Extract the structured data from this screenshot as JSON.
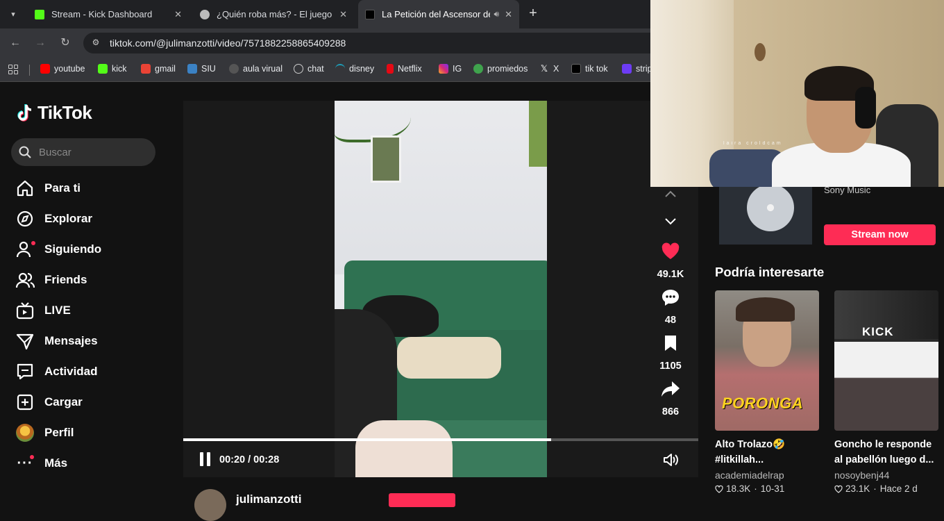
{
  "browser": {
    "tabs": [
      {
        "title": "Stream - Kick Dashboard",
        "active": false
      },
      {
        "title": "¿Quién roba más? - El juego qu",
        "active": false
      },
      {
        "title": "La Petición del Ascensor de",
        "active": true
      }
    ],
    "url": "tiktok.com/@julimanzotti/video/7571882258865409288",
    "bookmarks": [
      "youtube",
      "kick",
      "gmail",
      "SIU",
      "aula virual",
      "chat",
      "disney",
      "Netflix",
      "IG",
      "promiedos",
      "X",
      "tik tok",
      "strip"
    ]
  },
  "sidebar": {
    "logo": "TikTok",
    "search_placeholder": "Buscar",
    "items": [
      {
        "label": "Para ti",
        "icon": "home-icon"
      },
      {
        "label": "Explorar",
        "icon": "compass-icon"
      },
      {
        "label": "Siguiendo",
        "icon": "following-icon"
      },
      {
        "label": "Friends",
        "icon": "friends-icon"
      },
      {
        "label": "LIVE",
        "icon": "live-icon"
      },
      {
        "label": "Mensajes",
        "icon": "messages-icon"
      },
      {
        "label": "Actividad",
        "icon": "activity-icon"
      },
      {
        "label": "Cargar",
        "icon": "upload-icon"
      },
      {
        "label": "Perfil",
        "icon": "avatar-icon"
      },
      {
        "label": "Más",
        "icon": "more-icon"
      }
    ]
  },
  "player": {
    "time": "00:20 / 00:28",
    "progress": 0.714,
    "author": "julimanzotti"
  },
  "actions": {
    "likes": "49.1K",
    "comments": "48",
    "saves": "1105",
    "shares": "866"
  },
  "music": {
    "artist": "Sony Music",
    "stream_label": "Stream now"
  },
  "recommendations": {
    "title": "Podría interesarte",
    "items": [
      {
        "caption": "Alto Trolazo🤣 #litkillah...",
        "author": "academiadelrap",
        "likes": "18.3K",
        "date": "10-31",
        "thumb_text": "PORONGA"
      },
      {
        "caption": "Goncho le responde al pabellón luego d...",
        "author": "nosoybenj44",
        "likes": "23.1K",
        "date": "Hace 2 d",
        "thumb_text": "KICK"
      }
    ]
  },
  "webcam": {
    "overlay_text": "laira croldcam"
  },
  "colors": {
    "accent": "#fe2c55",
    "background": "#121212"
  }
}
